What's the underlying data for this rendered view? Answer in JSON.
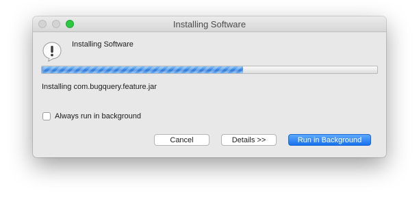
{
  "window": {
    "title": "Installing Software",
    "heading": "Installing Software",
    "icon": "alert-exclamation-icon"
  },
  "progress": {
    "fraction": 0.6
  },
  "status_text": "Installing com.bugquery.feature.jar",
  "options": {
    "background_label": "Always run in background",
    "background_checked": false
  },
  "buttons": {
    "cancel_label": "Cancel",
    "details_label": "Details >>",
    "run_background_label": "Run in Background"
  },
  "colors": {
    "accent": "#2c76d6",
    "primary_button": "#1871ee",
    "zoom_button": "#2bc840"
  }
}
